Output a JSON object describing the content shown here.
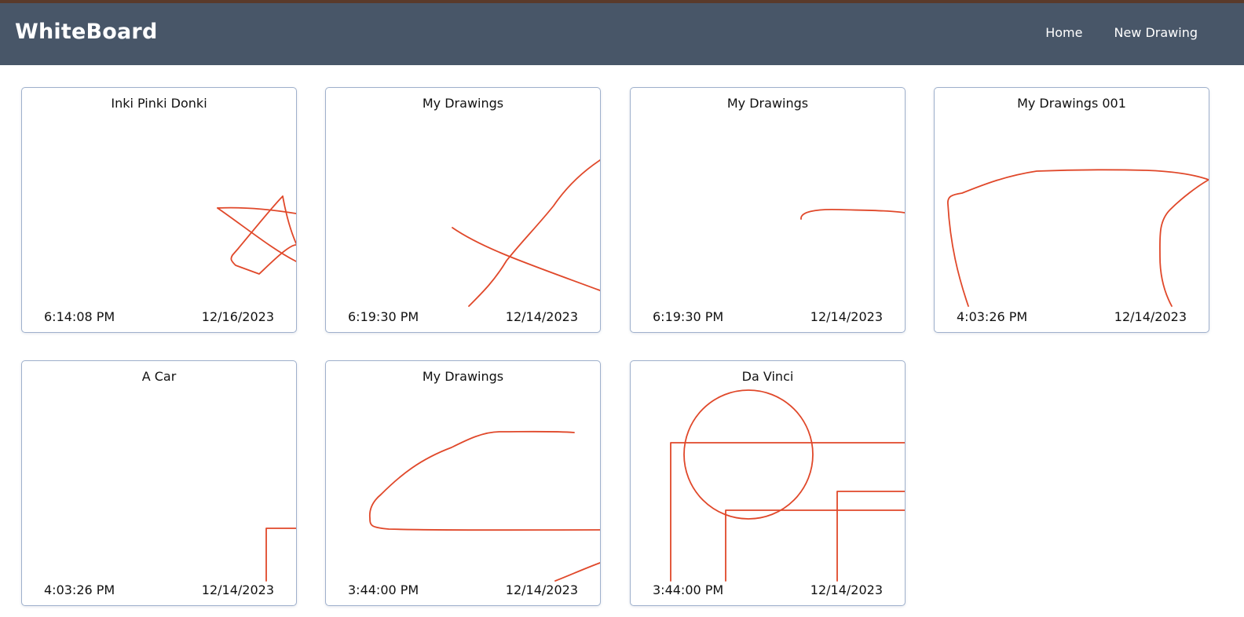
{
  "app": {
    "title": "WhiteBoard",
    "accent_color": "#485668",
    "stroke_color": "#e0482a"
  },
  "nav": {
    "home_label": "Home",
    "new_drawing_label": "New Drawing"
  },
  "drawings": [
    {
      "title": "Inki Pinki Donki",
      "time": "6:14:08 PM",
      "date": "12/16/2023"
    },
    {
      "title": "My Drawings",
      "time": "6:19:30 PM",
      "date": "12/14/2023"
    },
    {
      "title": "My Drawings",
      "time": "6:19:30 PM",
      "date": "12/14/2023"
    },
    {
      "title": "My Drawings 001",
      "time": "4:03:26 PM",
      "date": "12/14/2023"
    },
    {
      "title": "A Car",
      "time": "4:03:26 PM",
      "date": "12/14/2023"
    },
    {
      "title": "My Drawings",
      "time": "3:44:00 PM",
      "date": "12/14/2023"
    },
    {
      "title": "Da Vinci",
      "time": "3:44:00 PM",
      "date": "12/14/2023"
    }
  ]
}
